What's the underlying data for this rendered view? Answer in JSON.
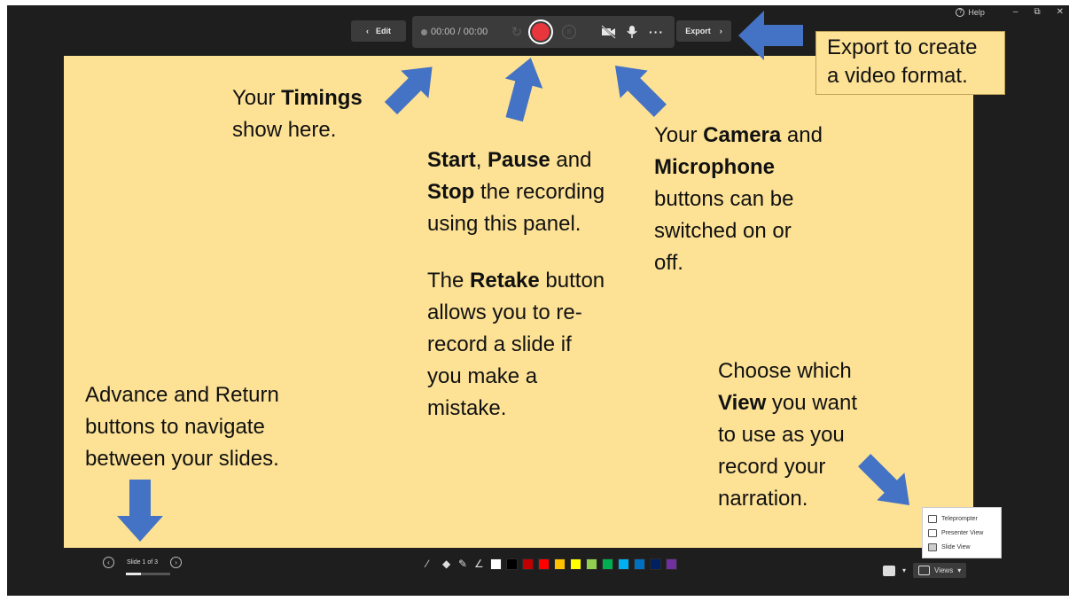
{
  "window": {
    "help_label": "Help",
    "minimize_glyph": "–",
    "restore_glyph": "⧉",
    "close_glyph": "✕"
  },
  "toolbar": {
    "edit_label": "Edit",
    "timer": "00:00 / 00:00",
    "more_glyph": "···",
    "export_label": "Export"
  },
  "callouts": {
    "export": [
      "Export to create",
      "a video format."
    ],
    "timings": [
      "Your Timings",
      "show here."
    ],
    "start": [
      "Start, Pause and",
      "Stop the recording",
      "using this panel."
    ],
    "retake": [
      "The Retake button",
      "allows you to re-",
      "record a slide if",
      "you make a",
      "mistake."
    ],
    "camera": [
      "Your Camera and",
      "Microphone",
      "buttons can be",
      "switched on or",
      "off."
    ],
    "nav": [
      "Advance and Return",
      "buttons to navigate",
      "between your slides."
    ],
    "view": [
      "Choose which",
      "View you want",
      "to use as you",
      "record your",
      "narration."
    ]
  },
  "navigation": {
    "slide_counter": "Slide 1 of 3",
    "progress_fraction": 0.33
  },
  "ink_colors": [
    "#ffffff",
    "#000000",
    "#c00000",
    "#ff0000",
    "#ffc000",
    "#ffff00",
    "#92d050",
    "#00b050",
    "#00b0f0",
    "#0070c0",
    "#002060",
    "#7030a0"
  ],
  "views": {
    "button_label": "Views",
    "menu": [
      "Teleprompter",
      "Presenter View",
      "Slide View"
    ],
    "selected": "Slide View"
  },
  "colors": {
    "slide_bg": "#fde295",
    "arrow_fill": "#4472c4",
    "record_red": "#e8363d"
  }
}
